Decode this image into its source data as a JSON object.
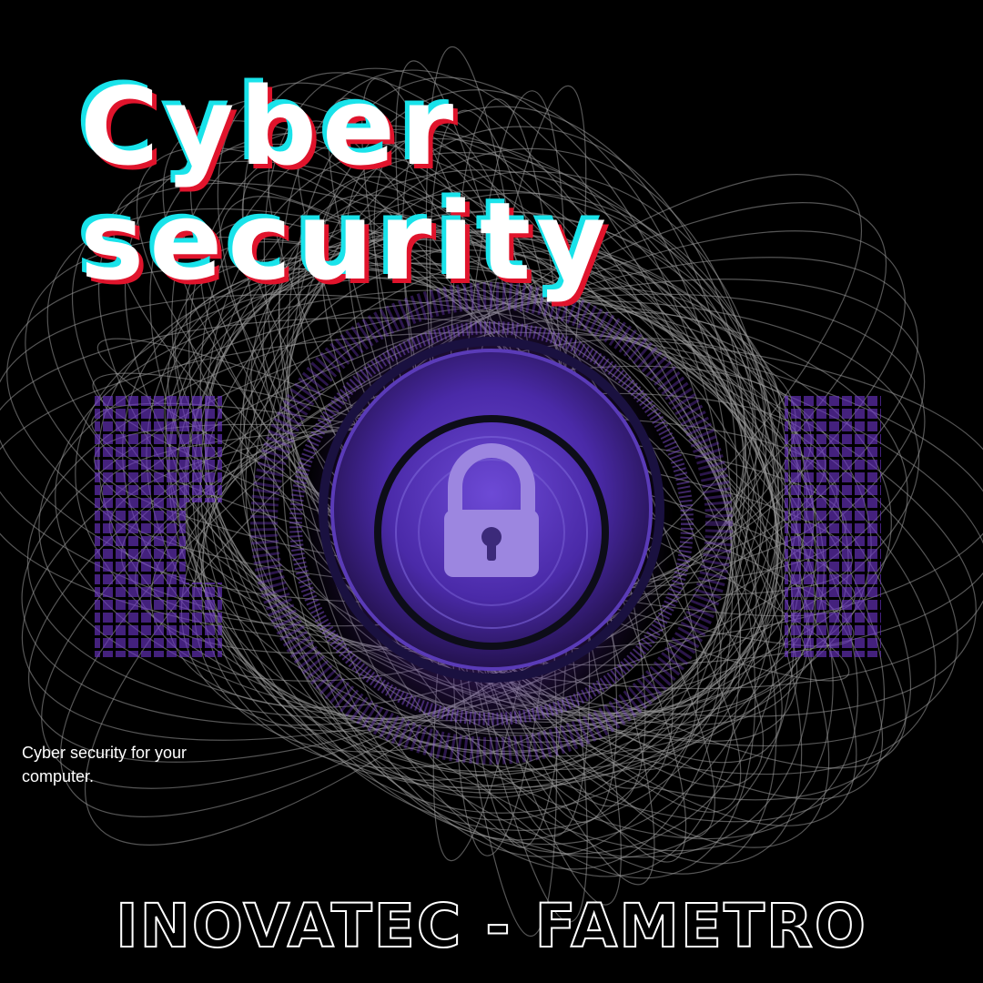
{
  "poster": {
    "title_line1": "Cyber",
    "title_line2": "security",
    "caption": "Cyber security for your computer.",
    "footer": "INOVATEC - FAMETRO"
  },
  "icons": {
    "center": "padlock-icon",
    "background": "wire-mesh-pattern"
  },
  "colors": {
    "background": "#000000",
    "title": "#ffffff",
    "title_shadow_cyan": "#19e3ea",
    "title_shadow_red": "#e0142c",
    "accent_purple": "#7a3fd6",
    "mesh": "#9a9a9a"
  }
}
